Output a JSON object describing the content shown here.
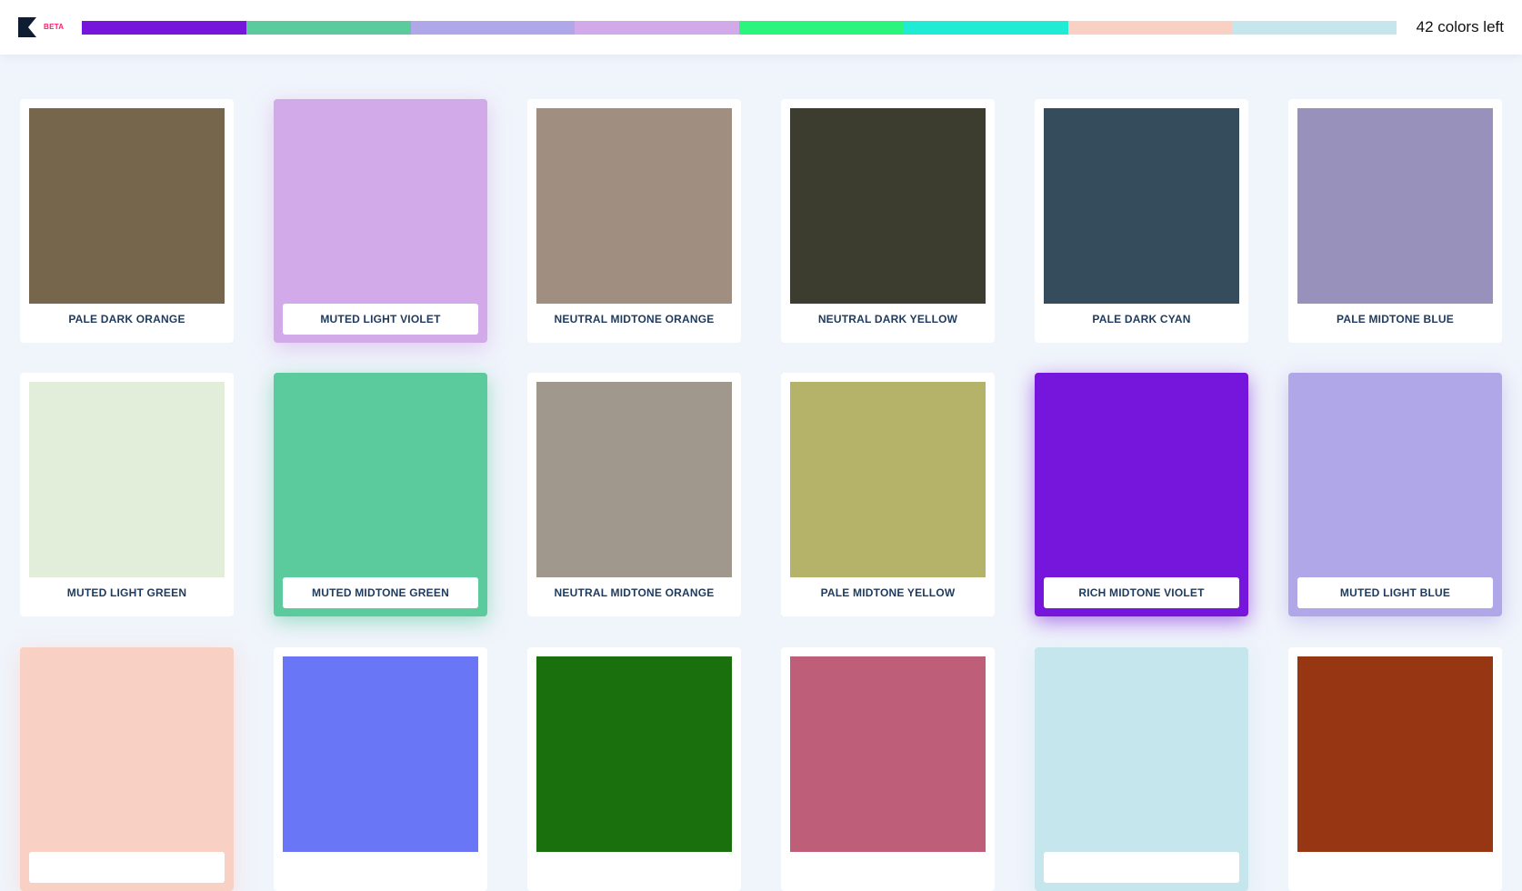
{
  "header": {
    "beta_label": "BETA",
    "colors_left": "42 colors left",
    "selected_palette": [
      "#7615db",
      "#5bcb9e",
      "#b0a7e8",
      "#d2aae9",
      "#2cf57e",
      "#20ecd6",
      "#f8d0c4",
      "#c6e6ed"
    ]
  },
  "cards": [
    {
      "name": "PALE DARK ORANGE",
      "color": "#76664b",
      "selected": false
    },
    {
      "name": "MUTED LIGHT VIOLET",
      "color": "#d2aae9",
      "selected": true
    },
    {
      "name": "NEUTRAL MIDTONE ORANGE",
      "color": "#a08f80",
      "selected": false
    },
    {
      "name": "NEUTRAL DARK YELLOW",
      "color": "#3c3d2f",
      "selected": false
    },
    {
      "name": "PALE DARK CYAN",
      "color": "#344c5c",
      "selected": false
    },
    {
      "name": "PALE MIDTONE BLUE",
      "color": "#9791bc",
      "selected": false
    },
    {
      "name": "MUTED LIGHT GREEN",
      "color": "#e2eeda",
      "selected": false
    },
    {
      "name": "MUTED MIDTONE GREEN",
      "color": "#5bcb9e",
      "selected": true
    },
    {
      "name": "NEUTRAL MIDTONE ORANGE",
      "color": "#a0978d",
      "selected": false
    },
    {
      "name": "PALE MIDTONE YELLOW",
      "color": "#b5b36a",
      "selected": false
    },
    {
      "name": "RICH MIDTONE VIOLET",
      "color": "#7615db",
      "selected": true
    },
    {
      "name": "MUTED LIGHT BLUE",
      "color": "#b0a7e8",
      "selected": true
    },
    {
      "name": "",
      "color": "#f8d0c4",
      "selected": true
    },
    {
      "name": "",
      "color": "#6976f5",
      "selected": false
    },
    {
      "name": "",
      "color": "#1b700e",
      "selected": false
    },
    {
      "name": "",
      "color": "#bf5e78",
      "selected": false
    },
    {
      "name": "",
      "color": "#c6e6ed",
      "selected": true
    },
    {
      "name": "",
      "color": "#963613",
      "selected": false
    }
  ]
}
